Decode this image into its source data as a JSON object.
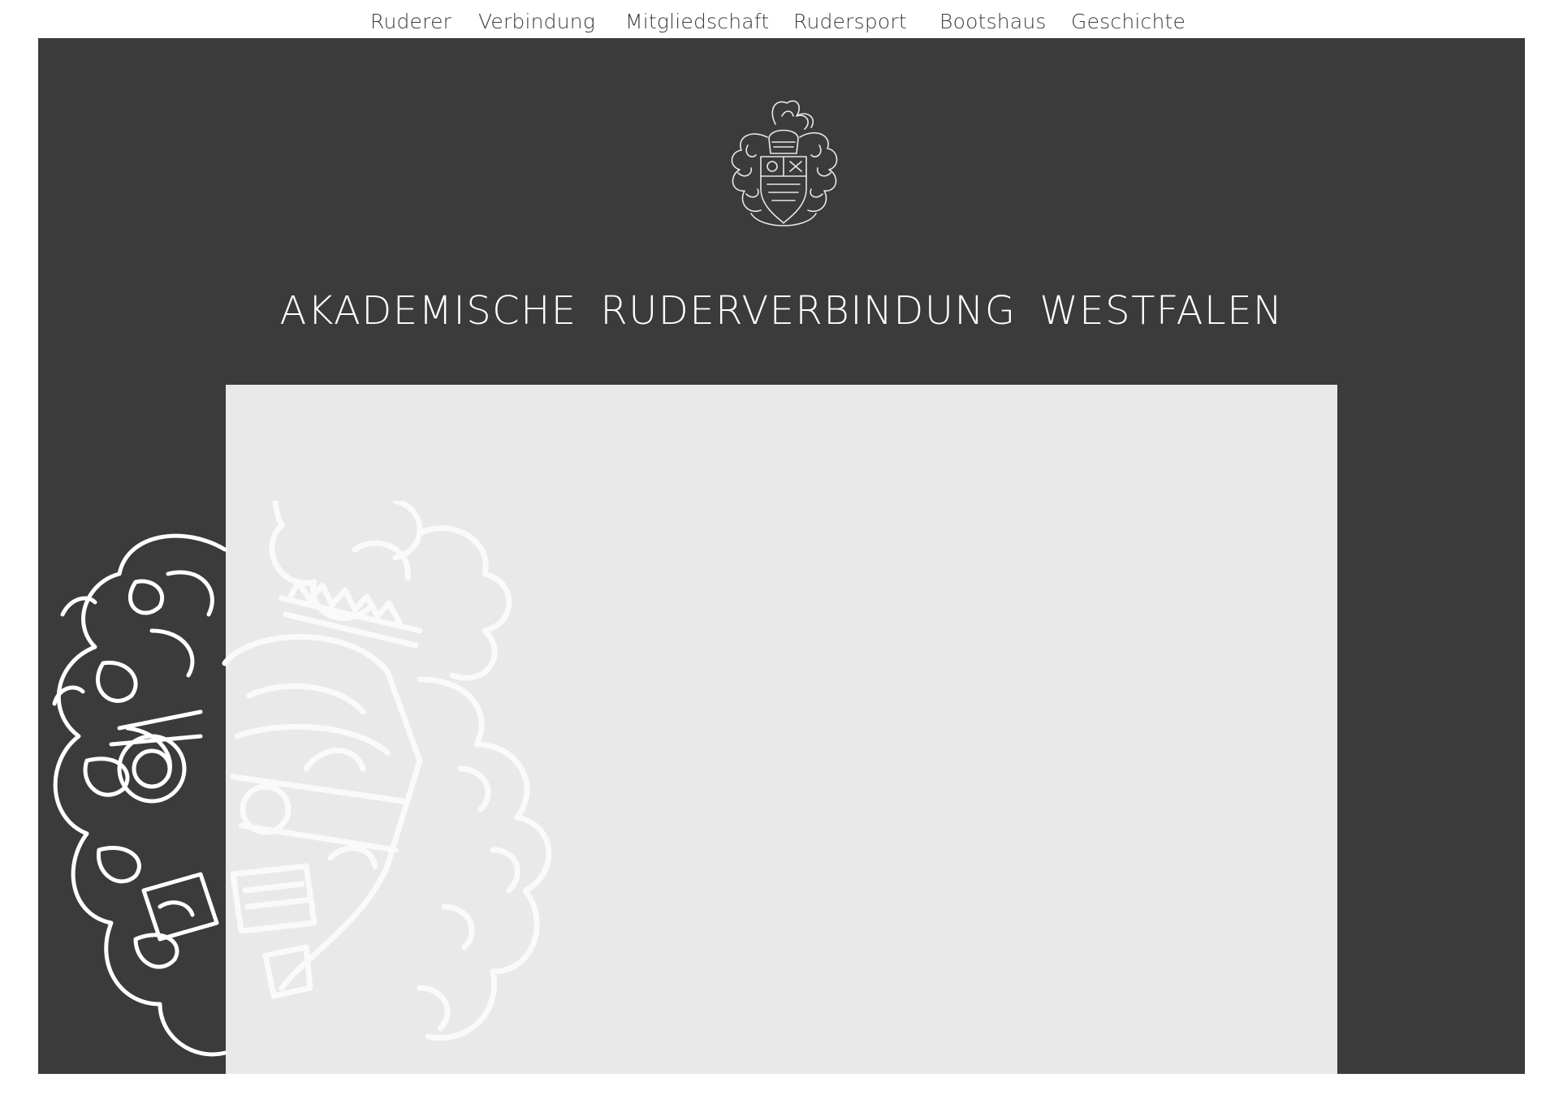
{
  "nav": {
    "items": [
      {
        "label": "Ruderer"
      },
      {
        "label": "Verbindung"
      },
      {
        "label": "Mitgliedschaft"
      },
      {
        "label": "Rudersport"
      },
      {
        "label": "Bootshaus"
      },
      {
        "label": "Geschichte"
      }
    ]
  },
  "hero": {
    "title": "AKADEMISCHE RUDERVERBINDUNG WESTFALEN",
    "logo_icon": "coat-of-arms-icon",
    "background_crest_icon": "coat-of-arms-watermark-icon"
  },
  "colors": {
    "hero_background": "#3b3b3b",
    "panel_background": "#e9e9e9",
    "nav_text": "#3c3c3c",
    "title_text": "#ffffff"
  }
}
